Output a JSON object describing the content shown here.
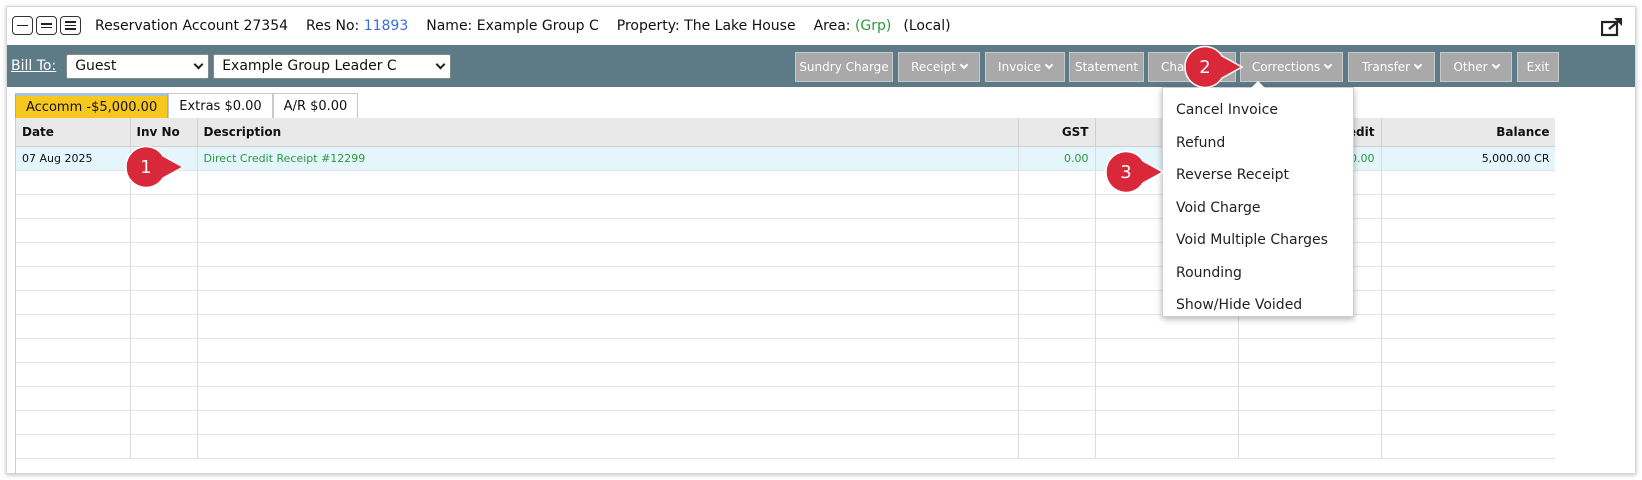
{
  "titlebar": {
    "account": "Reservation Account 27354",
    "res_label": "Res No:",
    "res_no": "11893",
    "name": "Name: Example Group C",
    "property": "Property: The Lake House",
    "area_label": "Area:",
    "area_grp": "(Grp)",
    "area_local": "(Local)"
  },
  "toolbar": {
    "bill_to": "Bill To:",
    "bill_to_select": "Guest",
    "guest_select": "Example Group Leader C",
    "buttons": {
      "sundry": "Sundry Charge",
      "receipt": "Receipt",
      "invoice": "Invoice",
      "statement": "Statement",
      "charge": "Cha",
      "corrections": "Corrections",
      "transfer": "Transfer",
      "other": "Other",
      "exit": "Exit"
    }
  },
  "tabs": [
    {
      "label": "Accomm -$5,000.00",
      "active": true
    },
    {
      "label": "Extras $0.00",
      "active": false
    },
    {
      "label": "A/R $0.00",
      "active": false
    }
  ],
  "table": {
    "columns": [
      "Date",
      "Inv No",
      "Description",
      "GST",
      "",
      "edit",
      "Balance"
    ],
    "rows": [
      {
        "date": "07 Aug 2025",
        "inv_no": "",
        "description": "Direct Credit Receipt #12299",
        "gst": "0.00",
        "debit": "",
        "credit": "0.00",
        "balance": "5,000.00 CR"
      }
    ]
  },
  "corrections_menu": [
    "Cancel Invoice",
    "Refund",
    "Reverse Receipt",
    "Void Charge",
    "Void Multiple Charges",
    "Rounding",
    "Show/Hide Voided"
  ],
  "callouts": [
    "1",
    "2",
    "3"
  ],
  "colors": {
    "toolbar_bg": "#5d7a87",
    "button_bg": "#a9a9a9",
    "active_tab": "#f6c81f",
    "callout_red": "#d9283a",
    "selected_row": "#e4f6fb",
    "receipt_green": "#2a9a3a"
  },
  "icons": [
    "minimize-icon",
    "restore-icon",
    "menu-icon",
    "popout-icon",
    "chevron-down-icon"
  ]
}
